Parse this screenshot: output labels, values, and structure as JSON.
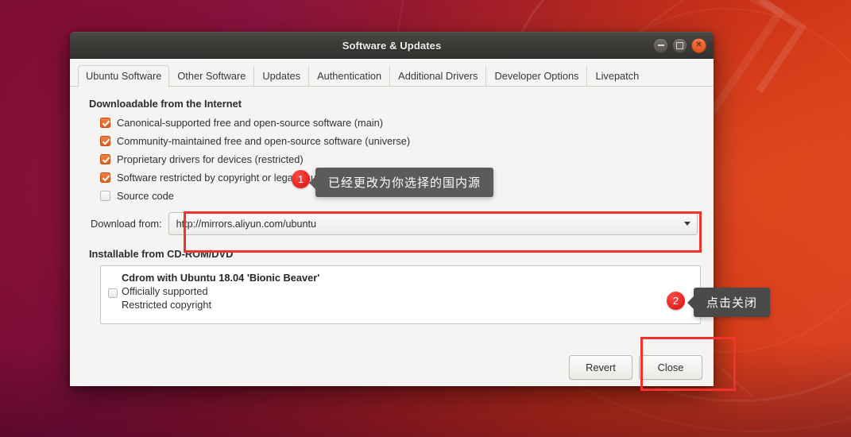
{
  "window": {
    "title": "Software & Updates",
    "controls": {
      "minimize": "minimize",
      "maximize": "maximize",
      "close": "close"
    }
  },
  "tabs": [
    {
      "label": "Ubuntu Software",
      "active": true
    },
    {
      "label": "Other Software",
      "active": false
    },
    {
      "label": "Updates",
      "active": false
    },
    {
      "label": "Authentication",
      "active": false
    },
    {
      "label": "Additional Drivers",
      "active": false
    },
    {
      "label": "Developer Options",
      "active": false
    },
    {
      "label": "Livepatch",
      "active": false
    }
  ],
  "internet_section": {
    "title": "Downloadable from the Internet",
    "checkboxes": [
      {
        "label": "Canonical-supported free and open-source software (main)",
        "checked": true
      },
      {
        "label": "Community-maintained free and open-source software (universe)",
        "checked": true
      },
      {
        "label": "Proprietary drivers for devices (restricted)",
        "checked": true
      },
      {
        "label": "Software restricted by copyright or legal issues (multiverse)",
        "checked": true
      },
      {
        "label": "Source code",
        "checked": false
      }
    ],
    "download_from": {
      "label": "Download from:",
      "value": "http://mirrors.aliyun.com/ubuntu",
      "caret": "chevron-down-icon"
    }
  },
  "cdrom_section": {
    "title": "Installable from CD-ROM/DVD",
    "item": {
      "title": "Cdrom with Ubuntu 18.04 'Bionic Beaver'",
      "lines": [
        "Officially supported",
        "Restricted copyright"
      ],
      "checked": false
    }
  },
  "footer": {
    "revert_label": "Revert",
    "close_label": "Close"
  },
  "annotations": {
    "badge_1": "1",
    "badge_2": "2",
    "tooltip_1": "已经更改为你选择的国内源",
    "tooltip_2": "点击关闭",
    "highlight_color": "#f2322d",
    "badge_color": "#e5211d"
  }
}
